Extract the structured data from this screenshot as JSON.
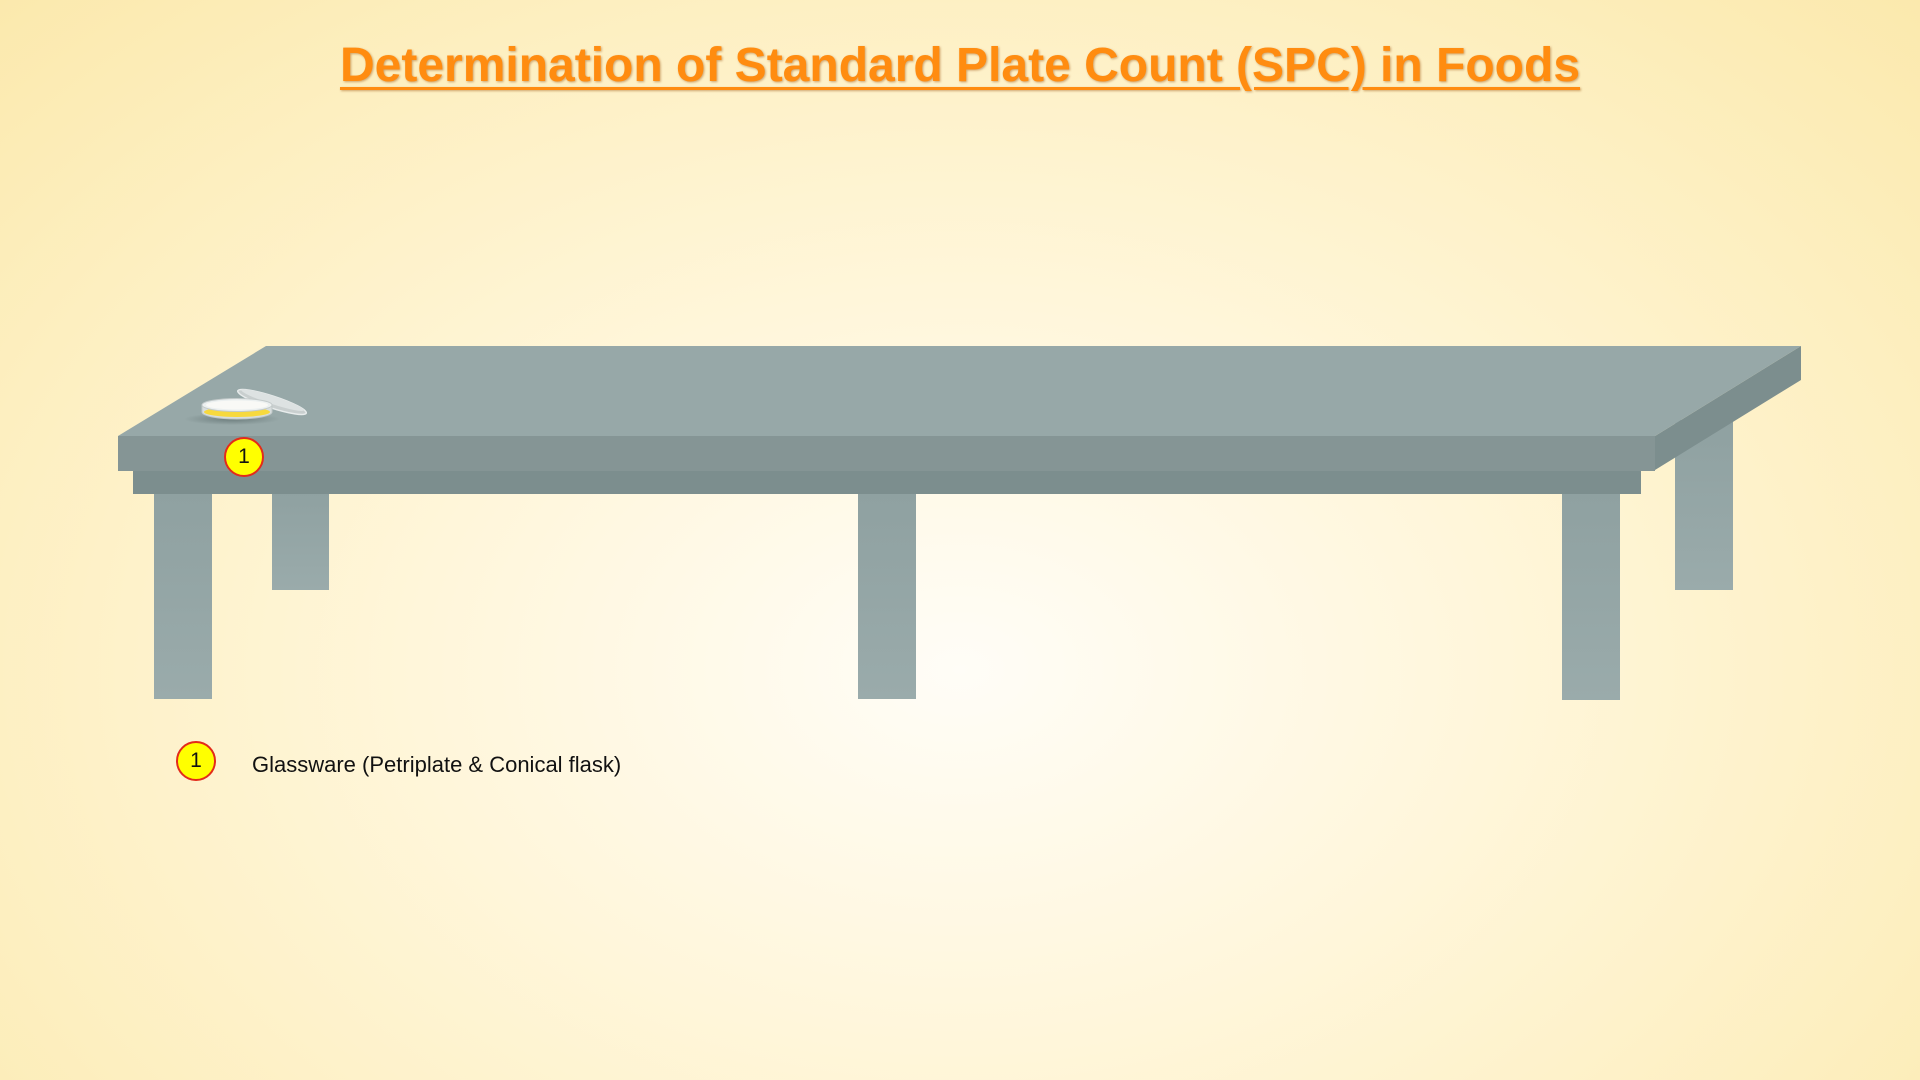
{
  "page": {
    "title": "Determination of Standard Plate Count (SPC) in Foods"
  },
  "scene": {
    "table_color": "#97a8a8",
    "table_front_color": "#859595",
    "table_apron_color": "#7c8e8e",
    "table_side_color": "#7c8e8e",
    "petriplate_icon": "petri-dish-icon",
    "callout_number": "1"
  },
  "legend": {
    "items": [
      {
        "number": "1",
        "label": "Glassware (Petriplate & Conical flask)"
      }
    ]
  },
  "colors": {
    "title": "#ff8c10",
    "badge_fill": "#ffff00",
    "badge_border": "#e32b1a",
    "agar": "#f7d93e"
  }
}
